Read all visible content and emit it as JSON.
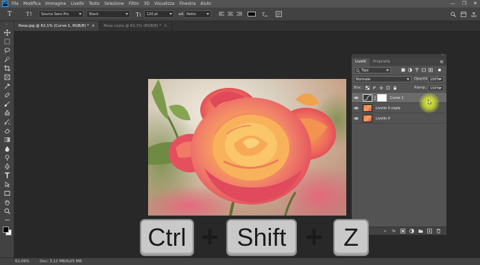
{
  "menubar": {
    "items": [
      "File",
      "Modifica",
      "Immagine",
      "Livello",
      "Testo",
      "Selezione",
      "Filtro",
      "3D",
      "Visualizza",
      "Finestra",
      "Aiuto"
    ],
    "window_controls": [
      "—",
      "❐",
      "✕"
    ]
  },
  "options": {
    "font_family": "Source Sans Pro",
    "font_style": "Black",
    "font_size": "120 pt",
    "aa_icon": "aA",
    "anti_alias": "Netto",
    "text_color": "#000000"
  },
  "tabs": [
    {
      "label": "Rosa.jpg @ 62,1% (Curve 1, RGB/8) *",
      "close": "×"
    },
    {
      "label": "Rosa copia @ 62,1% (RGB/8) *",
      "close": "×"
    }
  ],
  "layers_panel": {
    "tabs": [
      "Livelli",
      "Proprietà"
    ],
    "menu": "≡",
    "filter": "Tipo",
    "blend_mode": "Normale",
    "opacity_label": "Opacità:",
    "opacity": "100%",
    "lock_label": "Bloc.:",
    "fill_label": "Riemp.:",
    "fill": "100%",
    "layers": [
      {
        "name": "Curve 1",
        "selected": true
      },
      {
        "name": "Livello 0 copia",
        "selected": false
      },
      {
        "name": "Livello 0",
        "selected": false
      }
    ],
    "bottom_icons": [
      "link-icon",
      "fx-icon",
      "mask-icon",
      "adjustment-icon",
      "folder-icon",
      "new-layer-icon",
      "trash-icon"
    ],
    "bottom_labels": [
      "∞",
      "fx"
    ]
  },
  "statusbar": {
    "zoom": "62,09%",
    "doc": "Doc: 3,12 MB/6,25 MB",
    "arrow": "›"
  },
  "overlay": {
    "keys": [
      "Ctrl",
      "Shift",
      "Z"
    ],
    "plus": "+"
  },
  "colors": {
    "accent": "#31a8ff",
    "highlight": "#e8f53a"
  }
}
